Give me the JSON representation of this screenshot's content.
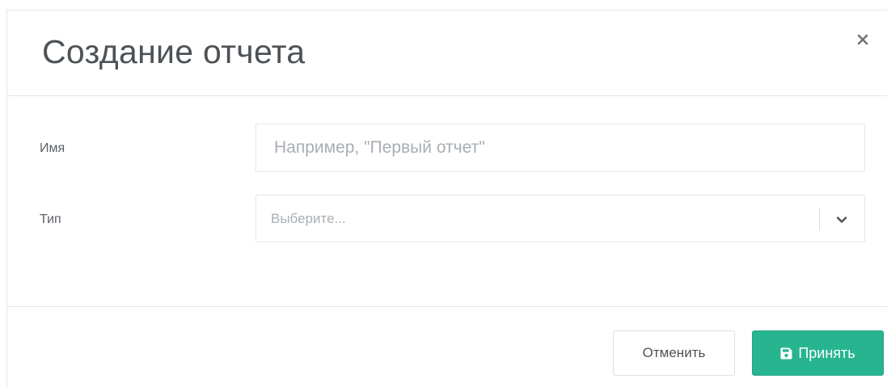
{
  "dialog": {
    "title": "Создание отчета",
    "close_icon": "close-icon"
  },
  "form": {
    "name": {
      "label": "Имя",
      "value": "",
      "placeholder": "Например, \"Первый отчет\""
    },
    "type": {
      "label": "Тип",
      "selected": "Выберите...",
      "arrow_icon": "chevron-down-icon"
    }
  },
  "footer": {
    "cancel_label": "Отменить",
    "accept_label": "Принять",
    "accept_icon": "save-icon"
  },
  "colors": {
    "accent": "#27b590",
    "title_text": "#4d5256",
    "placeholder_text": "#a9aeb3",
    "border": "#e3e6ea"
  }
}
